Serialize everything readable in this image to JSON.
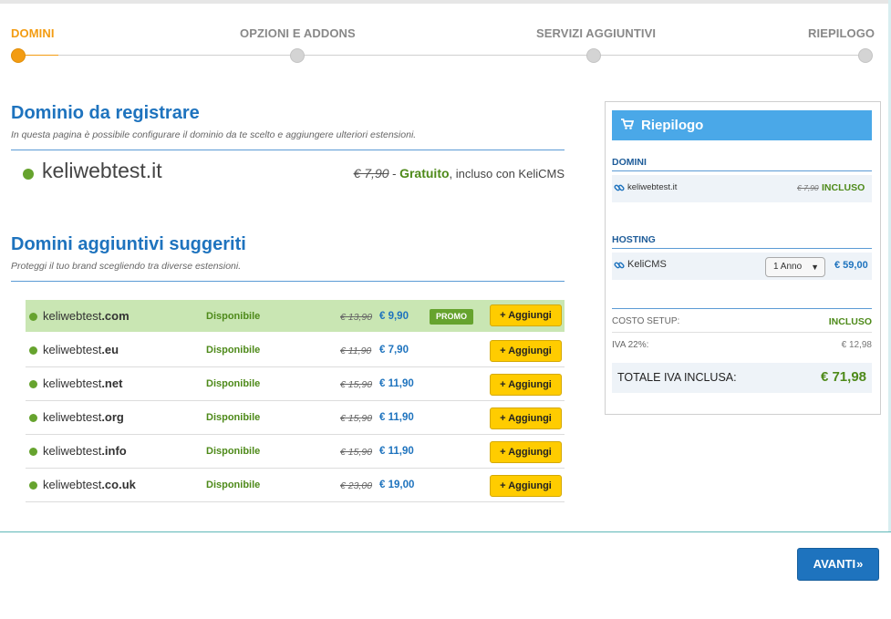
{
  "steps": [
    {
      "label": "DOMINI",
      "active": true
    },
    {
      "label": "OPZIONI E ADDONS",
      "active": false
    },
    {
      "label": "SERVIZI AGGIUNTIVI",
      "active": false
    },
    {
      "label": "RIEPILOGO",
      "active": false
    }
  ],
  "register": {
    "title": "Dominio da registrare",
    "subtitle": "In questa pagina è possibile configurare il dominio da te scelto e aggiungere ulteriori estensioni.",
    "domain": "keliwebtest.it",
    "old_price": "€ 7,90",
    "separator": " - ",
    "free_label": "Gratuito",
    "included_text": ", incluso con KeliCMS"
  },
  "suggested": {
    "title": "Domini aggiuntivi suggeriti",
    "subtitle": "Proteggi il tuo brand scegliendo tra diverse estensioni.",
    "add_label": "+ Aggiungi",
    "promo_label": "PROMO",
    "rows": [
      {
        "name": "keliwebtest",
        "ext": ".com",
        "status": "Disponibile",
        "old_price": "€ 13,90",
        "price": "€ 9,90",
        "promo": true
      },
      {
        "name": "keliwebtest",
        "ext": ".eu",
        "status": "Disponibile",
        "old_price": "€ 11,90",
        "price": "€ 7,90",
        "promo": false
      },
      {
        "name": "keliwebtest",
        "ext": ".net",
        "status": "Disponibile",
        "old_price": "€ 15,90",
        "price": "€ 11,90",
        "promo": false
      },
      {
        "name": "keliwebtest",
        "ext": ".org",
        "status": "Disponibile",
        "old_price": "€ 15,90",
        "price": "€ 11,90",
        "promo": false
      },
      {
        "name": "keliwebtest",
        "ext": ".info",
        "status": "Disponibile",
        "old_price": "€ 15,90",
        "price": "€ 11,90",
        "promo": false
      },
      {
        "name": "keliwebtest",
        "ext": ".co.uk",
        "status": "Disponibile",
        "old_price": "€ 23,00",
        "price": "€ 19,00",
        "promo": false
      }
    ]
  },
  "summary": {
    "title": "Riepilogo",
    "domains_label": "DOMINI",
    "domain_item": {
      "name": "keliwebtest.it",
      "old_price": "€ 7,90",
      "status": "INCLUSO"
    },
    "hosting_label": "HOSTING",
    "hosting_item": {
      "name": "KeliCMS",
      "period": "1 Anno",
      "price": "€ 59,00"
    },
    "setup_label": "COSTO SETUP:",
    "setup_value": "INCLUSO",
    "vat_label": "IVA 22%:",
    "vat_value": "€ 12,98",
    "total_label": "TOTALE IVA INCLUSA:",
    "total_value": "€ 71,98"
  },
  "next_button": {
    "label": "AVANTI",
    "icon": "double-chevron-right-icon"
  },
  "colors": {
    "accent": "#f39c12",
    "primary": "#1e73be",
    "success": "#66a32e",
    "button": "#ffcc00",
    "panel_head": "#4aa8e8"
  }
}
